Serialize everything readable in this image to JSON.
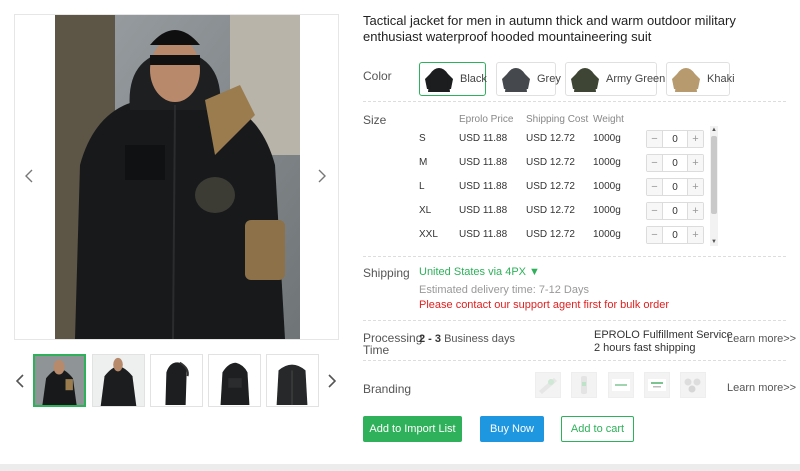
{
  "product": {
    "title": "Tactical jacket for men in autumn thick and warm outdoor military enthusiast waterproof hooded mountaineering suit"
  },
  "gallery": {
    "thumbnails": [
      "jacket-front-worn",
      "jacket-front-zip",
      "jacket-side-hood",
      "jacket-back",
      "jacket-hood-up"
    ],
    "active_index": 0
  },
  "color": {
    "label": "Color",
    "options": [
      {
        "label": "Black",
        "selected": true
      },
      {
        "label": "Grey",
        "selected": false
      },
      {
        "label": "Army Green",
        "selected": false
      },
      {
        "label": "Khaki",
        "selected": false
      }
    ]
  },
  "size": {
    "label": "Size",
    "columns": {
      "price": "Eprolo Price",
      "shipping": "Shipping Cost",
      "weight": "Weight"
    },
    "rows": [
      {
        "size": "S",
        "price": "USD 11.88",
        "shipping": "USD 12.72",
        "weight": "1000g",
        "qty": "0"
      },
      {
        "size": "M",
        "price": "USD 11.88",
        "shipping": "USD 12.72",
        "weight": "1000g",
        "qty": "0"
      },
      {
        "size": "L",
        "price": "USD 11.88",
        "shipping": "USD 12.72",
        "weight": "1000g",
        "qty": "0"
      },
      {
        "size": "XL",
        "price": "USD 11.88",
        "shipping": "USD 12.72",
        "weight": "1000g",
        "qty": "0"
      },
      {
        "size": "XXL",
        "price": "USD 11.88",
        "shipping": "USD 12.72",
        "weight": "1000g",
        "qty": "0"
      }
    ],
    "minus": "−",
    "plus": "+"
  },
  "shipping": {
    "label": "Shipping",
    "method": "United States via 4PX ▼",
    "estimate": "Estimated delivery time: 7-12 Days",
    "warning": "Please contact our support agent first for bulk order"
  },
  "processing": {
    "label_line1": "Processing",
    "label_line2": "Time",
    "days_bold": "2 - 3",
    "days_text": " Business days",
    "service_line1": "EPROLO Fulfillment Service",
    "service_line2": "2 hours fast shipping",
    "learn_more": "Learn more>>"
  },
  "branding": {
    "label": "Branding",
    "items": [
      "sticker",
      "bottle",
      "card",
      "card-green",
      "badges"
    ],
    "learn_more": "Learn more>>"
  },
  "actions": {
    "add_import": "Add to Import List",
    "buy_now": "Buy Now",
    "add_cart": "Add to cart"
  },
  "colors": {
    "accent_green": "#2eb15a",
    "buy_blue": "#1e96e0",
    "warning_red": "#e02020"
  }
}
